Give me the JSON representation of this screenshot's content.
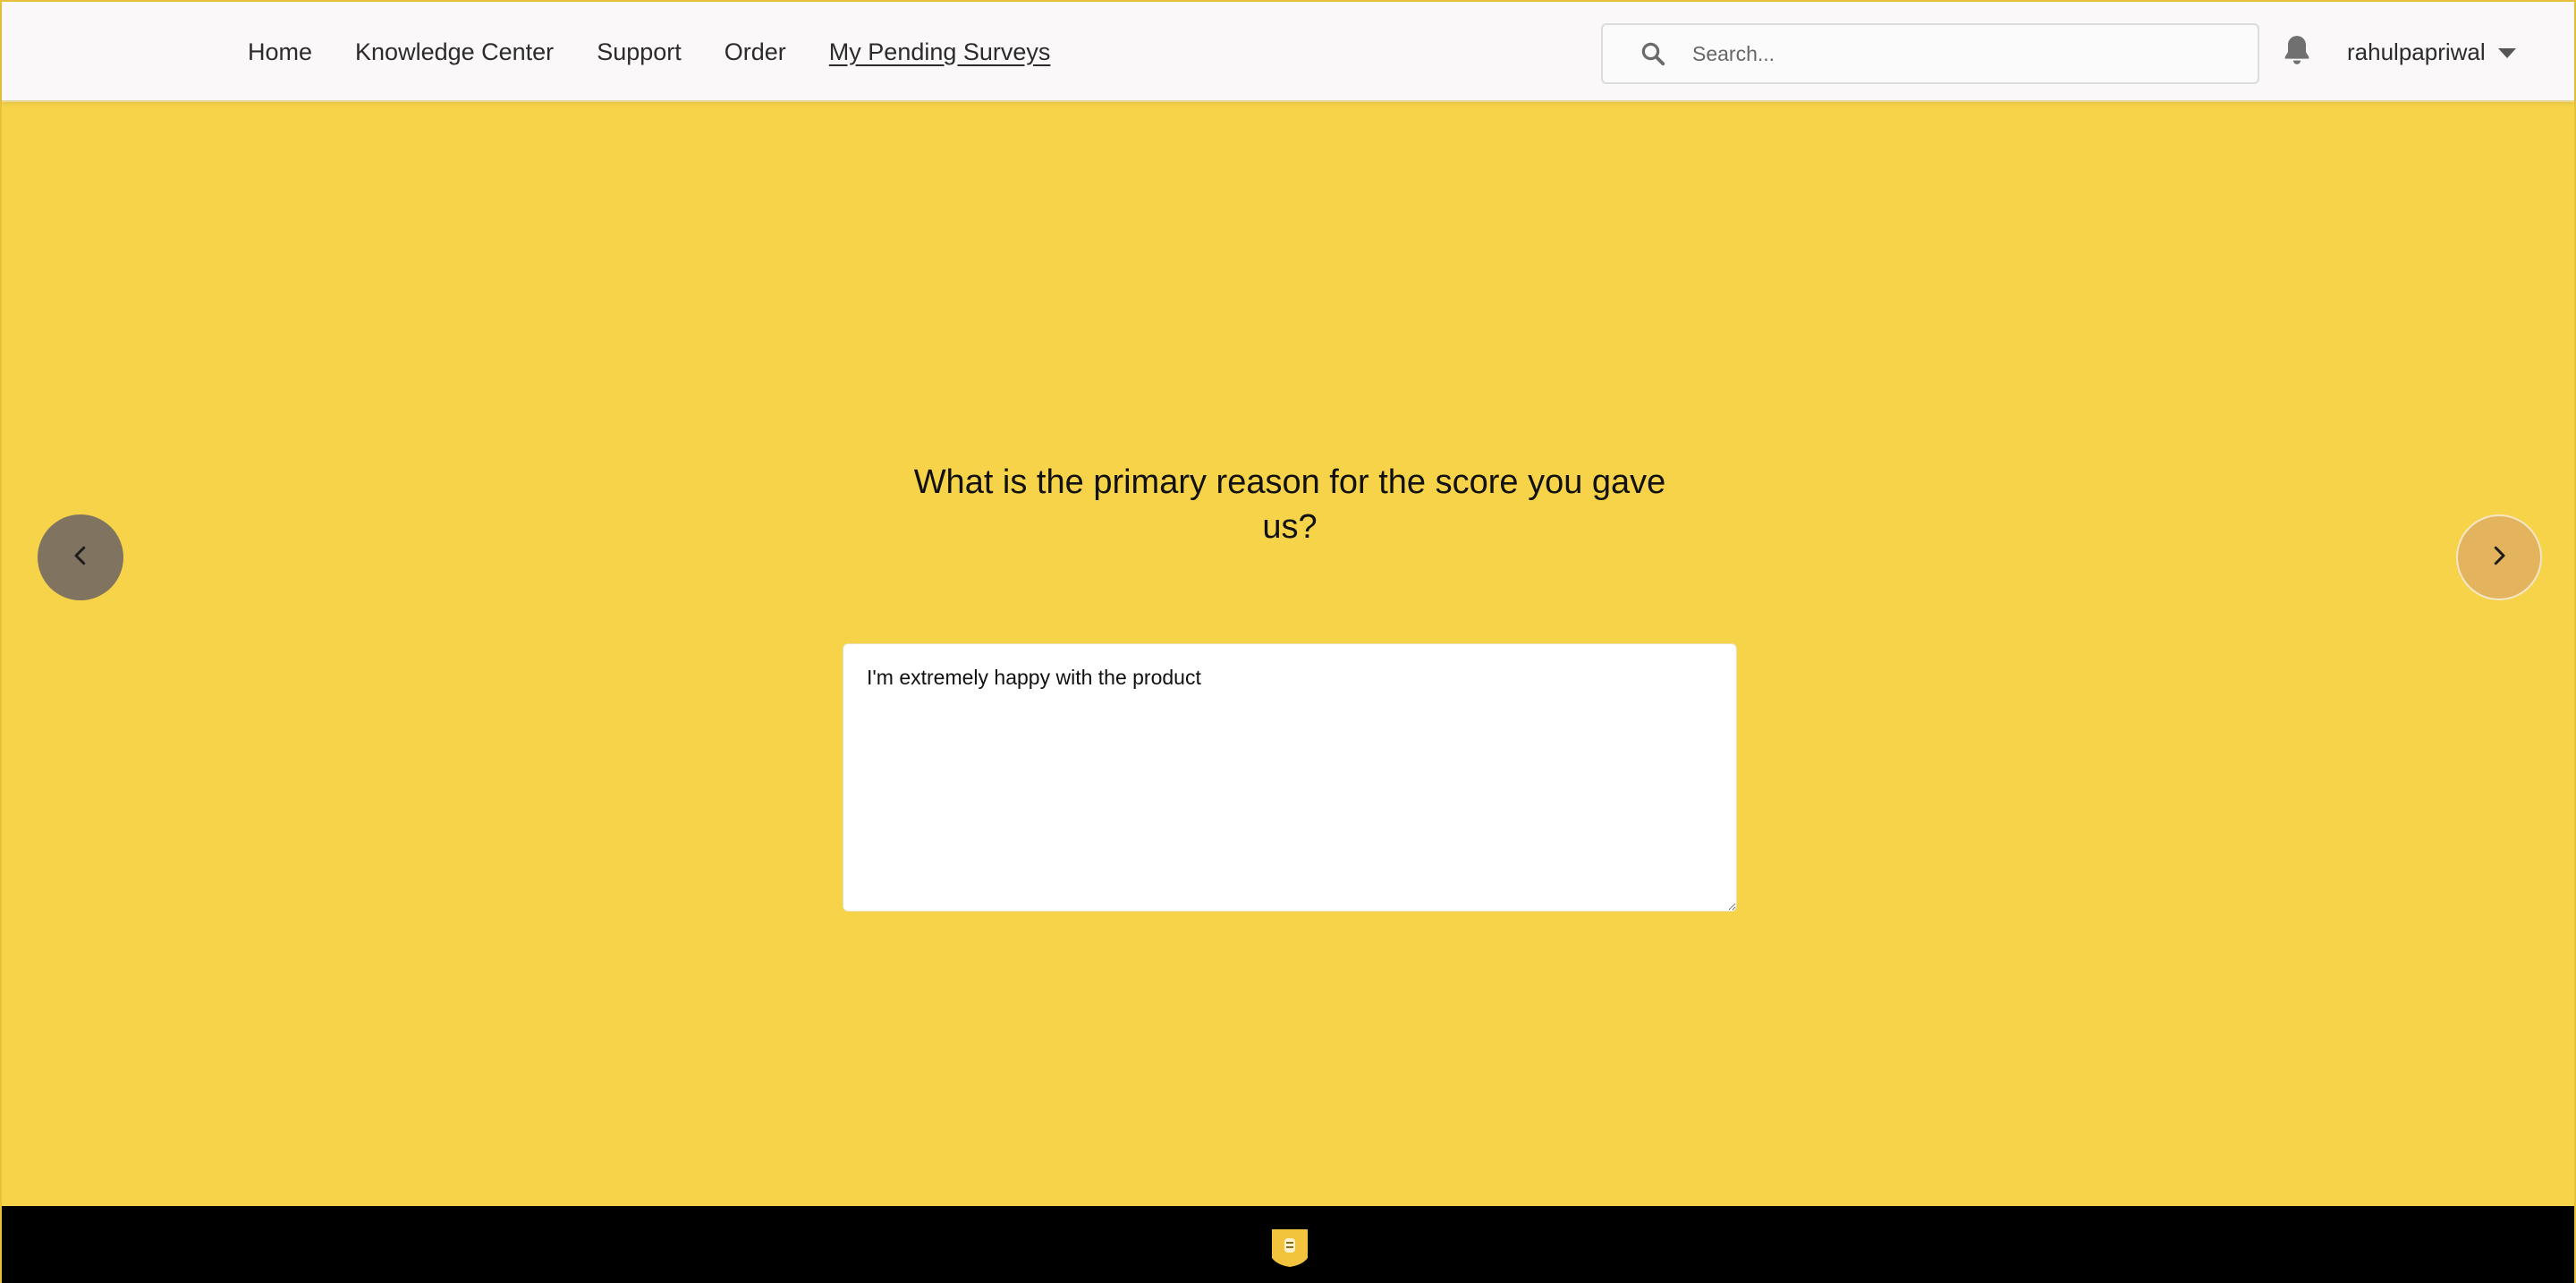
{
  "nav": {
    "items": [
      {
        "label": "Home"
      },
      {
        "label": "Knowledge Center"
      },
      {
        "label": "Support"
      },
      {
        "label": "Order"
      },
      {
        "label": "My Pending Surveys",
        "active": true
      }
    ]
  },
  "search": {
    "placeholder": "Search...",
    "icon": "search-icon"
  },
  "notifications": {
    "icon": "bell-icon"
  },
  "user": {
    "name": "rahulpapriwal",
    "menu_icon": "chevron-down-icon"
  },
  "survey": {
    "question": "What is the primary reason for the score you gave us?",
    "answer": "I'm extremely happy with the product",
    "prev_icon": "chevron-left-icon",
    "next_icon": "chevron-right-icon"
  },
  "footer": {
    "logo_icon": "brand-logo-icon"
  },
  "colors": {
    "background": "#f7d349",
    "header": "#faf8f8",
    "prev_button": "#807461",
    "next_button": "#e4b35e",
    "footer": "#000000"
  }
}
